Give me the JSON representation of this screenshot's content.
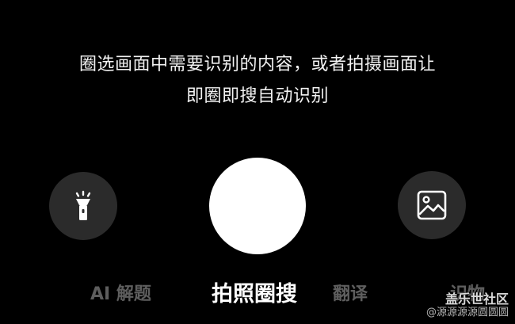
{
  "hint": {
    "line1": "圈选画面中需要识别的内容，或者拍摄画面让",
    "line2": "即圈即搜自动识别"
  },
  "controls": {
    "flash_icon": "flashlight-icon",
    "gallery_icon": "image-gallery-icon"
  },
  "modes": [
    {
      "label": "AI 解题",
      "active": false
    },
    {
      "label": "拍照圈搜",
      "active": true
    },
    {
      "label": "翻译",
      "active": false
    },
    {
      "label": "识物",
      "active": false
    }
  ],
  "watermark": {
    "title": "盖乐世社区",
    "sub": "@源源源源圆圆圆"
  },
  "colors": {
    "background": "#000000",
    "shutter": "#ffffff",
    "side_button": "#2b2b2b",
    "inactive_mode": "#5e5e5e"
  }
}
